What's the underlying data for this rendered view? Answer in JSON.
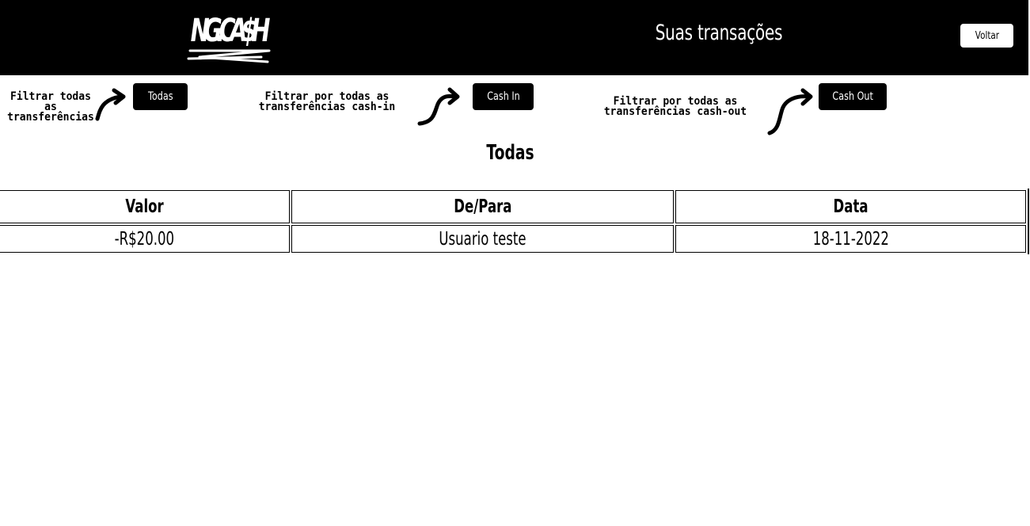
{
  "header": {
    "logo_text": "NG.CA$H",
    "title": "Suas transações",
    "back_label": "Voltar"
  },
  "filters": [
    {
      "label": "Filtrar todas as transferências",
      "button": "Todas"
    },
    {
      "label": "Filtrar por todas as transferências cash-in",
      "button": "Cash In"
    },
    {
      "label": "Filtrar por todas as transferências cash-out",
      "button": "Cash Out"
    }
  ],
  "section": {
    "title": "Todas"
  },
  "table": {
    "columns": [
      "Valor",
      "De/Para",
      "Data"
    ],
    "rows": [
      [
        "-R$20.00",
        "Usuario teste",
        "18-11-2022"
      ]
    ]
  },
  "colors": {
    "header_bg": "#000000",
    "page_bg": "#ffffff",
    "button_bg": "#000000"
  },
  "icons": [
    "ngcash-logo",
    "curved-arrow-icon"
  ]
}
